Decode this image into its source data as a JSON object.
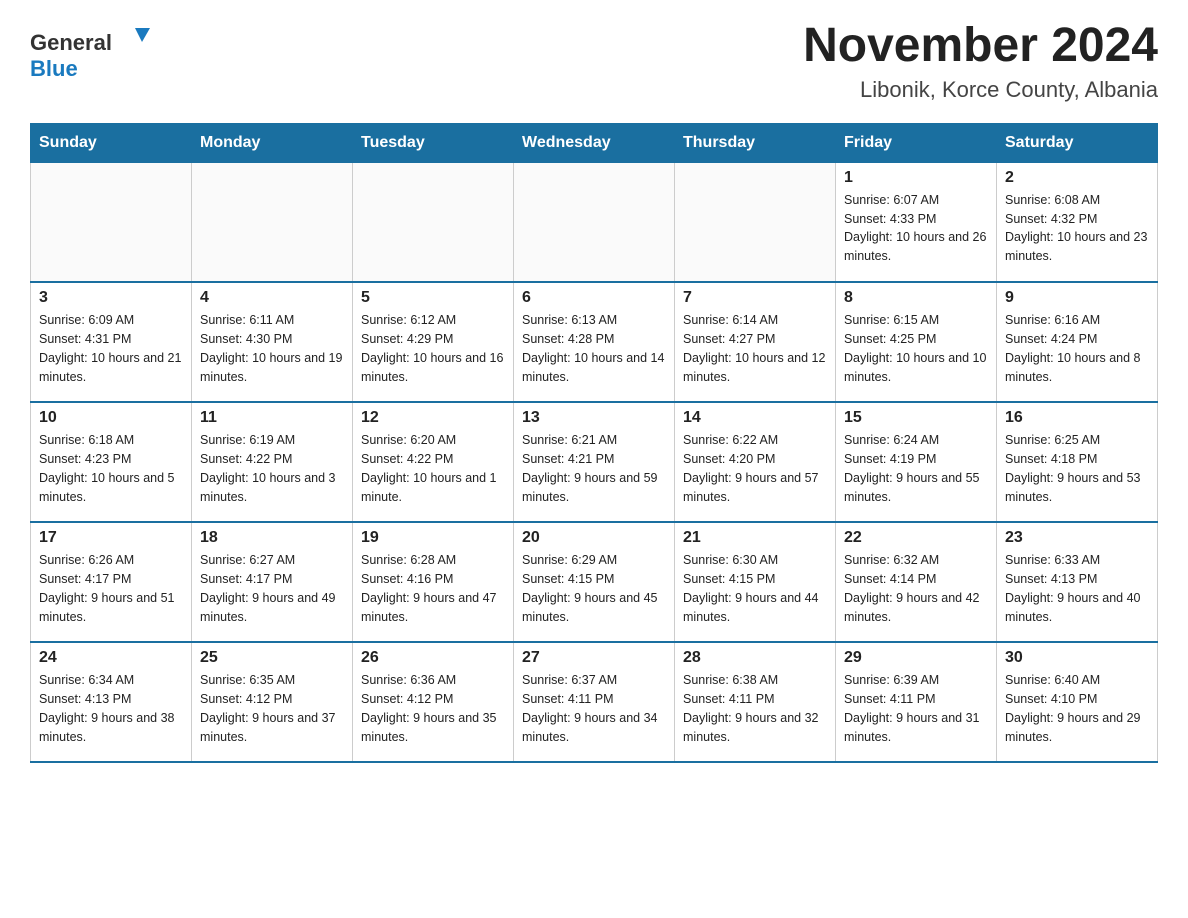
{
  "header": {
    "logo_general": "General",
    "logo_blue": "Blue",
    "title": "November 2024",
    "subtitle": "Libonik, Korce County, Albania"
  },
  "calendar": {
    "weekdays": [
      "Sunday",
      "Monday",
      "Tuesday",
      "Wednesday",
      "Thursday",
      "Friday",
      "Saturday"
    ],
    "weeks": [
      [
        {
          "day": "",
          "info": ""
        },
        {
          "day": "",
          "info": ""
        },
        {
          "day": "",
          "info": ""
        },
        {
          "day": "",
          "info": ""
        },
        {
          "day": "",
          "info": ""
        },
        {
          "day": "1",
          "info": "Sunrise: 6:07 AM\nSunset: 4:33 PM\nDaylight: 10 hours and 26 minutes."
        },
        {
          "day": "2",
          "info": "Sunrise: 6:08 AM\nSunset: 4:32 PM\nDaylight: 10 hours and 23 minutes."
        }
      ],
      [
        {
          "day": "3",
          "info": "Sunrise: 6:09 AM\nSunset: 4:31 PM\nDaylight: 10 hours and 21 minutes."
        },
        {
          "day": "4",
          "info": "Sunrise: 6:11 AM\nSunset: 4:30 PM\nDaylight: 10 hours and 19 minutes."
        },
        {
          "day": "5",
          "info": "Sunrise: 6:12 AM\nSunset: 4:29 PM\nDaylight: 10 hours and 16 minutes."
        },
        {
          "day": "6",
          "info": "Sunrise: 6:13 AM\nSunset: 4:28 PM\nDaylight: 10 hours and 14 minutes."
        },
        {
          "day": "7",
          "info": "Sunrise: 6:14 AM\nSunset: 4:27 PM\nDaylight: 10 hours and 12 minutes."
        },
        {
          "day": "8",
          "info": "Sunrise: 6:15 AM\nSunset: 4:25 PM\nDaylight: 10 hours and 10 minutes."
        },
        {
          "day": "9",
          "info": "Sunrise: 6:16 AM\nSunset: 4:24 PM\nDaylight: 10 hours and 8 minutes."
        }
      ],
      [
        {
          "day": "10",
          "info": "Sunrise: 6:18 AM\nSunset: 4:23 PM\nDaylight: 10 hours and 5 minutes."
        },
        {
          "day": "11",
          "info": "Sunrise: 6:19 AM\nSunset: 4:22 PM\nDaylight: 10 hours and 3 minutes."
        },
        {
          "day": "12",
          "info": "Sunrise: 6:20 AM\nSunset: 4:22 PM\nDaylight: 10 hours and 1 minute."
        },
        {
          "day": "13",
          "info": "Sunrise: 6:21 AM\nSunset: 4:21 PM\nDaylight: 9 hours and 59 minutes."
        },
        {
          "day": "14",
          "info": "Sunrise: 6:22 AM\nSunset: 4:20 PM\nDaylight: 9 hours and 57 minutes."
        },
        {
          "day": "15",
          "info": "Sunrise: 6:24 AM\nSunset: 4:19 PM\nDaylight: 9 hours and 55 minutes."
        },
        {
          "day": "16",
          "info": "Sunrise: 6:25 AM\nSunset: 4:18 PM\nDaylight: 9 hours and 53 minutes."
        }
      ],
      [
        {
          "day": "17",
          "info": "Sunrise: 6:26 AM\nSunset: 4:17 PM\nDaylight: 9 hours and 51 minutes."
        },
        {
          "day": "18",
          "info": "Sunrise: 6:27 AM\nSunset: 4:17 PM\nDaylight: 9 hours and 49 minutes."
        },
        {
          "day": "19",
          "info": "Sunrise: 6:28 AM\nSunset: 4:16 PM\nDaylight: 9 hours and 47 minutes."
        },
        {
          "day": "20",
          "info": "Sunrise: 6:29 AM\nSunset: 4:15 PM\nDaylight: 9 hours and 45 minutes."
        },
        {
          "day": "21",
          "info": "Sunrise: 6:30 AM\nSunset: 4:15 PM\nDaylight: 9 hours and 44 minutes."
        },
        {
          "day": "22",
          "info": "Sunrise: 6:32 AM\nSunset: 4:14 PM\nDaylight: 9 hours and 42 minutes."
        },
        {
          "day": "23",
          "info": "Sunrise: 6:33 AM\nSunset: 4:13 PM\nDaylight: 9 hours and 40 minutes."
        }
      ],
      [
        {
          "day": "24",
          "info": "Sunrise: 6:34 AM\nSunset: 4:13 PM\nDaylight: 9 hours and 38 minutes."
        },
        {
          "day": "25",
          "info": "Sunrise: 6:35 AM\nSunset: 4:12 PM\nDaylight: 9 hours and 37 minutes."
        },
        {
          "day": "26",
          "info": "Sunrise: 6:36 AM\nSunset: 4:12 PM\nDaylight: 9 hours and 35 minutes."
        },
        {
          "day": "27",
          "info": "Sunrise: 6:37 AM\nSunset: 4:11 PM\nDaylight: 9 hours and 34 minutes."
        },
        {
          "day": "28",
          "info": "Sunrise: 6:38 AM\nSunset: 4:11 PM\nDaylight: 9 hours and 32 minutes."
        },
        {
          "day": "29",
          "info": "Sunrise: 6:39 AM\nSunset: 4:11 PM\nDaylight: 9 hours and 31 minutes."
        },
        {
          "day": "30",
          "info": "Sunrise: 6:40 AM\nSunset: 4:10 PM\nDaylight: 9 hours and 29 minutes."
        }
      ]
    ]
  }
}
